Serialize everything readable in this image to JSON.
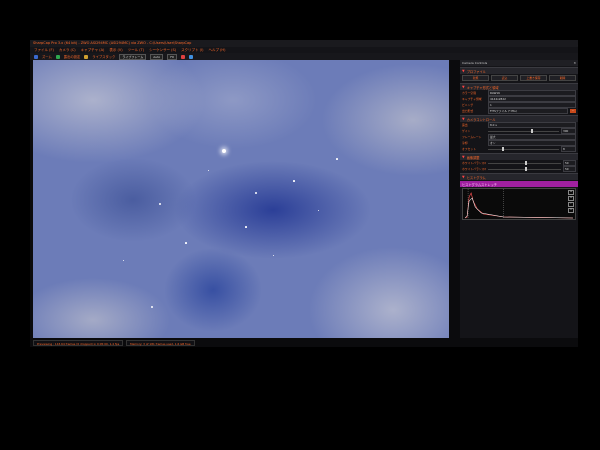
{
  "window": {
    "title": "SharpCap Pro 3.x (64 bit) - ZWO ASI294MC (ASI294MC) via ZWO - C:\\Users\\User\\SharpCap",
    "controls": [
      "_",
      "□",
      "✕"
    ]
  },
  "menu": [
    "ファイル (F)",
    "カメラ (C)",
    "キャプチャ (A)",
    "表示 (V)",
    "ツール (T)",
    "シーケンサー (S)",
    "スクリプト (I)",
    "ヘルプ (H)"
  ],
  "toolbar": {
    "items": [
      "ズーム",
      "露出の設定",
      "ライブスタック",
      "ライブフレーム"
    ],
    "zoom": "Auto",
    "frames": "ライブフレーム",
    "capture": "Fit"
  },
  "colors": {
    "accent": "#ff6a2a",
    "histogram": "#a020a0",
    "button": "#c9491a"
  },
  "panel": {
    "header": "Camera Controls",
    "sections": {
      "profile": "プロファイル",
      "capture_format": "キャプチャ形式と領域",
      "camera": "カメラコントロール",
      "image": "画像調整",
      "histogram": "ヒストグラム"
    },
    "tabs": [
      "新規",
      "読込",
      "上書き保存",
      "削除"
    ],
    "rows": [
      {
        "label": "カラー空間",
        "value": "RAW16"
      },
      {
        "label": "キャプチャ領域",
        "value": "4144x2822"
      },
      {
        "label": "ビニング",
        "value": "1"
      },
      {
        "label": "出力形式",
        "value": "FITSファイル (*.fits)"
      },
      {
        "label": "露出",
        "value": "8.0 s"
      },
      {
        "label": "ゲイン",
        "value": "300"
      },
      {
        "label": "フレームレート",
        "value": "最大"
      },
      {
        "label": "冷却",
        "value": "オン"
      },
      {
        "label": "ホワイトバランス(R)",
        "value": "50"
      },
      {
        "label": "ホワイトバランス(B)",
        "value": "50"
      },
      {
        "label": "オフセット",
        "value": "8"
      }
    ],
    "histogram_label": "ヒストグラムストレッチ",
    "histogram_buttons": [
      "A",
      "B",
      "C",
      "D"
    ]
  },
  "status": {
    "left": "Previewing : 143.64 frames (0 dropped) in 0:05:00, 1.4 fps",
    "mid": "Memory: 3 of 181 frames used, 1.6 GB free"
  }
}
